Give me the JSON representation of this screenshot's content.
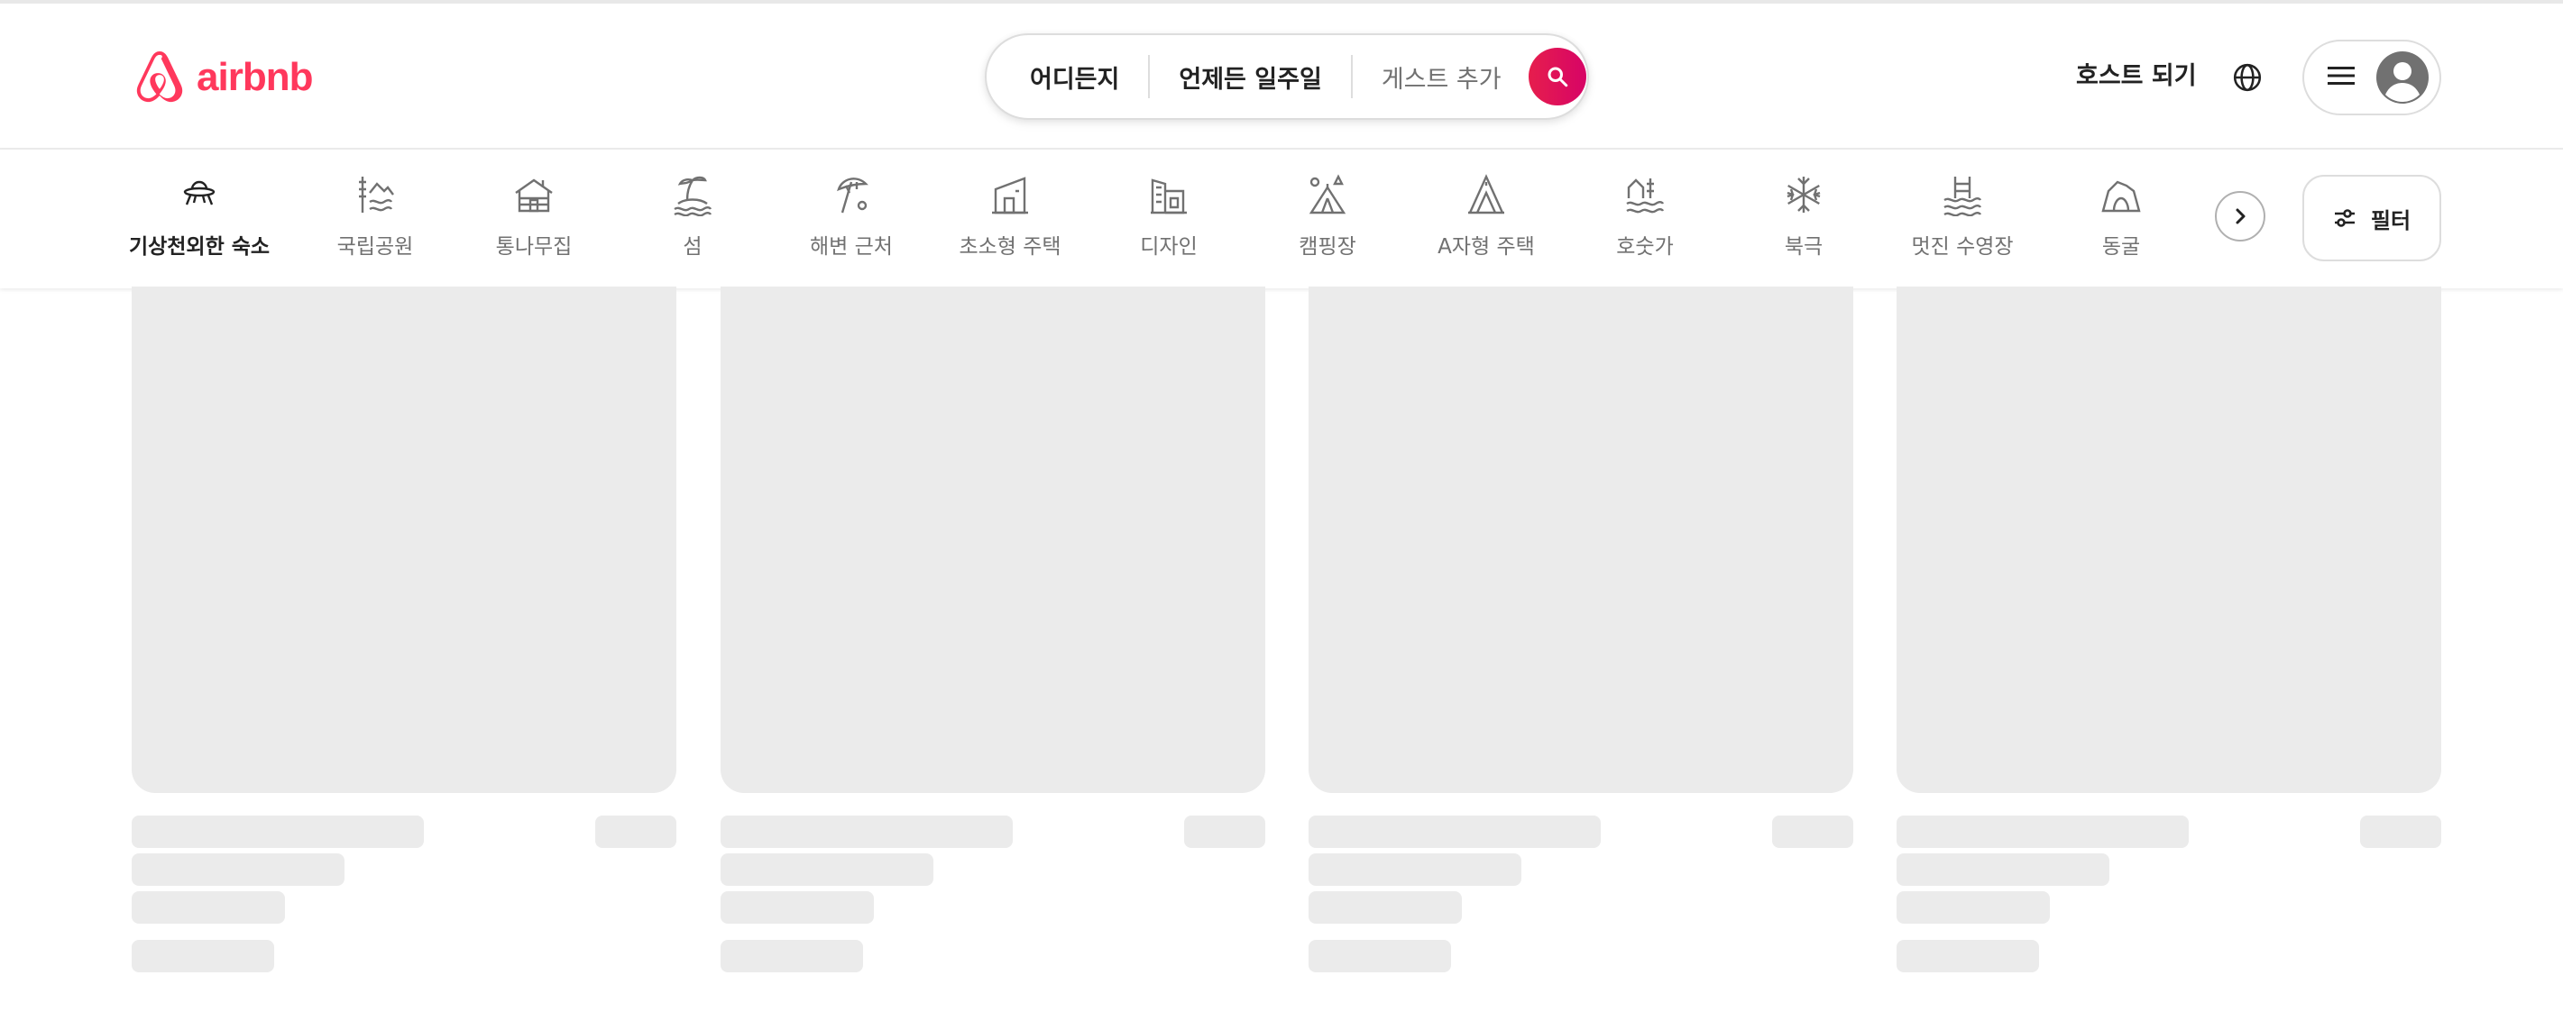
{
  "brand": {
    "name": "airbnb",
    "color": "#ff385c"
  },
  "search": {
    "where": "어디든지",
    "when": "언제든 일주일",
    "guests": "게스트 추가",
    "button_icon": "search-icon"
  },
  "header": {
    "host_link": "호스트 되기",
    "globe_icon": "globe-icon",
    "menu_icon": "hamburger-icon",
    "avatar_icon": "avatar-icon"
  },
  "categories": [
    {
      "label": "기상천외한 숙소",
      "icon": "ufo-icon",
      "active": true
    },
    {
      "label": "국립공원",
      "icon": "national-park-icon"
    },
    {
      "label": "통나무집",
      "icon": "cabin-icon"
    },
    {
      "label": "섬",
      "icon": "island-icon"
    },
    {
      "label": "해변 근처",
      "icon": "beach-umbrella-icon"
    },
    {
      "label": "초소형 주택",
      "icon": "tiny-home-icon"
    },
    {
      "label": "디자인",
      "icon": "design-icon"
    },
    {
      "label": "캠핑장",
      "icon": "camping-icon"
    },
    {
      "label": "A자형 주택",
      "icon": "a-frame-icon"
    },
    {
      "label": "호숫가",
      "icon": "lakefront-icon"
    },
    {
      "label": "북극",
      "icon": "snowflake-icon"
    },
    {
      "label": "멋진 수영장",
      "icon": "pool-icon"
    },
    {
      "label": "동굴",
      "icon": "cave-icon"
    }
  ],
  "category_next_icon": "chevron-right-icon",
  "filter": {
    "label": "필터",
    "icon": "sliders-icon"
  },
  "listing_placeholders": 4
}
